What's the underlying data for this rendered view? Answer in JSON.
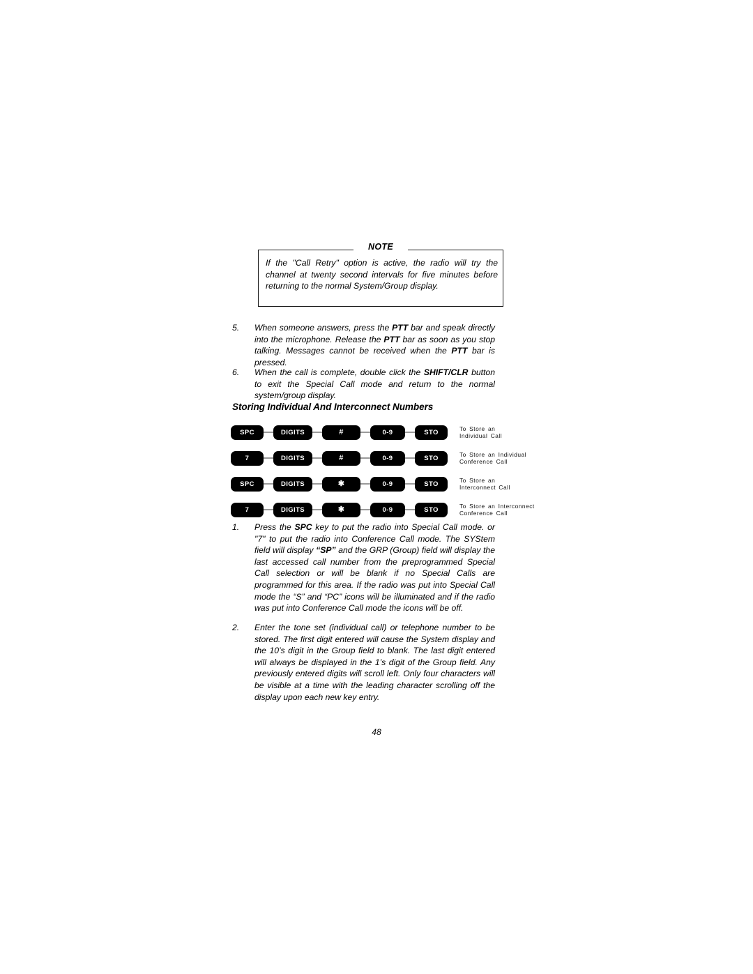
{
  "document": {
    "page_number": "48"
  },
  "note": {
    "label": "NOTE",
    "body": "If the \"Call Retry\" option is active, the radio will try the channel at twenty second intervals for five minutes before returning to the normal System/Group display."
  },
  "steps": [
    {
      "number": "5.",
      "text_parts": [
        {
          "t": "When someone answers, press the ",
          "b": false
        },
        {
          "t": "PTT",
          "b": true
        },
        {
          "t": " bar and speak directly into the microphone.  Release the ",
          "b": false
        },
        {
          "t": "PTT",
          "b": true
        },
        {
          "t": " bar as soon as you stop talking. Messages cannot be received when the ",
          "b": false
        },
        {
          "t": "PTT",
          "b": true
        },
        {
          "t": " bar is pressed.",
          "b": false
        }
      ]
    },
    {
      "number": "6.",
      "text_parts": [
        {
          "t": "When the call is complete, double click the ",
          "b": false
        },
        {
          "t": "SHIFT/CLR",
          "b": true
        },
        {
          "t": " button to exit the Special Call mode and return to the normal system/group display.",
          "b": false
        }
      ]
    },
    {
      "number": "1.",
      "text_parts": [
        {
          "t": "Press the ",
          "b": false
        },
        {
          "t": "SPC",
          "b": true
        },
        {
          "t": " key to put the radio into Special Call mode. or \"7\" to put the radio into Conference Call mode.  The SYStem field will display ",
          "b": false
        },
        {
          "t": "“SP”",
          "b": true
        },
        {
          "t": " and the GRP (Group) field will display the last accessed call number from the preprogrammed Special Call selection  or will be blank if no Special Calls are programmed for this area.  If the radio was put into Special Call mode the “S” and “PC” icons will be illuminated and if the radio was put into Conference Call mode the icons will be off.",
          "b": false
        }
      ]
    },
    {
      "number": "2.",
      "text_parts": [
        {
          "t": "Enter the tone set (individual call) or telephone number to be stored. The first digit entered will cause the System display and the 10’s digit in the Group field to blank.  The last digit entered will always be displayed in the 1’s digit of the Group field.  Any previously entered digits will scroll left.  Only four characters will be visible at a time with the leading character scrolling off the display upon each new key entry.",
          "b": false
        }
      ]
    }
  ],
  "section": {
    "heading": "Storing Individual And Interconnect Numbers"
  },
  "key_diagram": {
    "rows": [
      {
        "keys": [
          "SPC",
          "DIGITS",
          "#",
          "0-9",
          "STO"
        ],
        "description_lines": [
          "To Store  an",
          "Individual  Call"
        ]
      },
      {
        "keys": [
          "7",
          "DIGITS",
          "#",
          "0-9",
          "STO"
        ],
        "description_lines": [
          "To  Store  an  Individual",
          "Conference  Call"
        ]
      },
      {
        "keys": [
          "SPC",
          "DIGITS",
          "✱",
          "0-9",
          "STO"
        ],
        "description_lines": [
          "To  Store  an",
          "Interconnect  Call"
        ]
      },
      {
        "keys": [
          "7",
          "DIGITS",
          "✱",
          "0-9",
          "STO"
        ],
        "description_lines": [
          "To  Store  an  Interconnect",
          "Conference  Call"
        ]
      }
    ]
  },
  "colors": {
    "key_fill": "#000000",
    "key_text": "#ffffff",
    "connector": "#9a9a9a",
    "rule": "#1a1a1a",
    "text": "#000000"
  }
}
